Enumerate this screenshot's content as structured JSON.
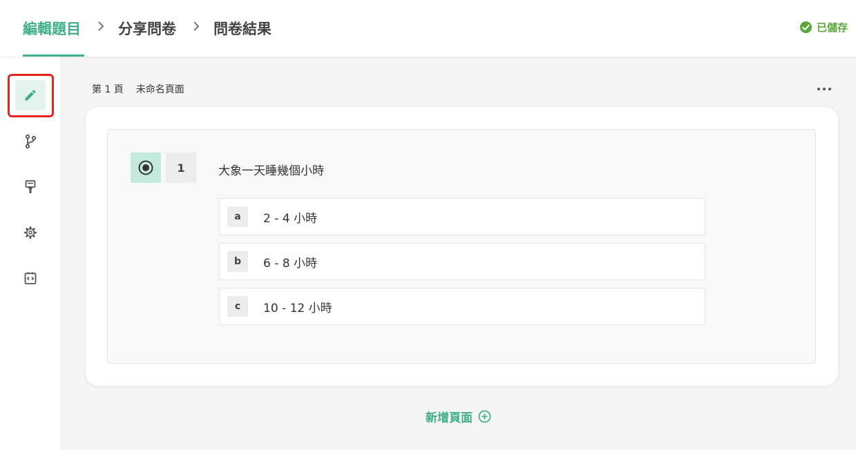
{
  "header": {
    "breadcrumbs": [
      {
        "label": "編輯題目",
        "active": true
      },
      {
        "label": "分享問卷",
        "active": false
      },
      {
        "label": "問卷結果",
        "active": false
      }
    ],
    "saved_status": "已儲存",
    "accent_color": "#3fae8a",
    "saved_color": "#5aa83a"
  },
  "sidebar": {
    "items": [
      {
        "icon": "pencil-icon",
        "name": "edit",
        "active": true
      },
      {
        "icon": "branch-icon",
        "name": "logic",
        "active": false
      },
      {
        "icon": "paint-roller-icon",
        "name": "theme",
        "active": false
      },
      {
        "icon": "gear-icon",
        "name": "settings",
        "active": false
      },
      {
        "icon": "code-icon",
        "name": "embed",
        "active": false
      }
    ],
    "highlight_color": "#e8231b"
  },
  "page": {
    "number_label": "第 1 頁",
    "name": "未命名頁面",
    "add_page_label": "新增頁面"
  },
  "question": {
    "type_icon": "radio-icon",
    "number": "1",
    "title": "大象一天睡幾個小時",
    "options": [
      {
        "key": "a",
        "text": "2 - 4 小時"
      },
      {
        "key": "b",
        "text": "6 - 8 小時"
      },
      {
        "key": "c",
        "text": "10 - 12 小時"
      }
    ]
  }
}
